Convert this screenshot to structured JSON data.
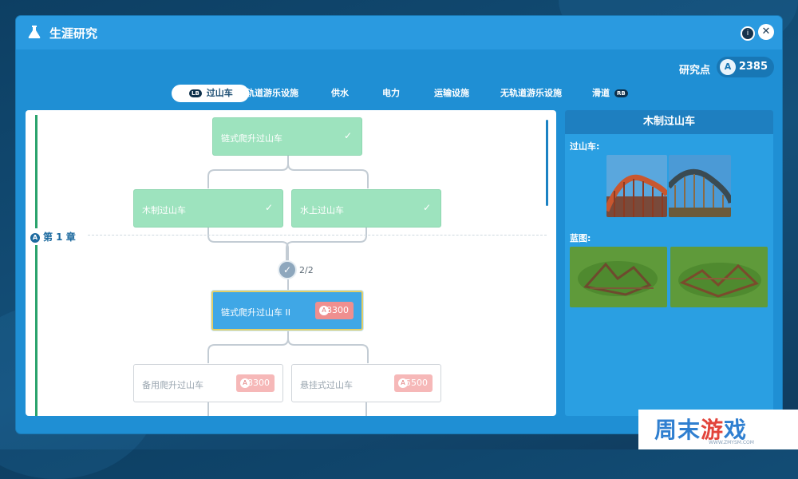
{
  "window": {
    "title": "生涯研究",
    "help_icon": "i",
    "close_icon": "✕"
  },
  "research_points": {
    "label": "研究点",
    "value": "2385",
    "icon": "A"
  },
  "tabs": [
    {
      "label": "过山车",
      "bumper": "LB",
      "active": true
    },
    {
      "label": "轨道游乐设施"
    },
    {
      "label": "供水"
    },
    {
      "label": "电力"
    },
    {
      "label": "运输设施"
    },
    {
      "label": "无轨道游乐设施"
    },
    {
      "label": "滑道",
      "bumper": "RB"
    }
  ],
  "tree": {
    "chapter_label": "第 1 章",
    "chapter_icon": "A",
    "counter": "2/2",
    "counter_icon": "✓",
    "nodes": {
      "chain_lift": {
        "label": "链式爬升过山车",
        "check": "✓"
      },
      "wooden": {
        "label": "木制过山车",
        "check": "✓"
      },
      "water": {
        "label": "水上过山车",
        "check": "✓"
      },
      "chain_lift_2": {
        "label": "链式爬升过山车 II",
        "cost": "8300",
        "cost_icon": "A"
      },
      "backup_lift": {
        "label": "备用爬升过山车",
        "cost": "8300",
        "cost_icon": "A"
      },
      "suspended": {
        "label": "悬挂式过山车",
        "cost": "5500",
        "cost_icon": "A"
      }
    }
  },
  "detail": {
    "title": "木制过山车",
    "rides_label": "过山车:",
    "blueprints_label": "蓝图:"
  },
  "watermark": {
    "blue1": "周末",
    "red": "游",
    "blue2": "戏",
    "url": "WWW.ZMYSM.COM"
  }
}
